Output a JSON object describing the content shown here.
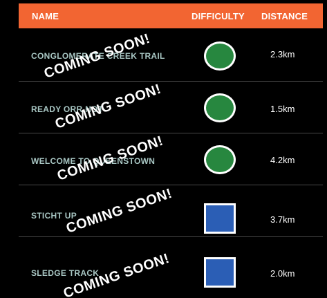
{
  "colors": {
    "header_background": "#f26532",
    "page_background": "#000000",
    "header_text": "#ffffff",
    "trail_name_text": "#a8c6c3",
    "easy_green": "#27873f",
    "intermediate_blue": "#2b5eb5",
    "divider": "#4a4a4a"
  },
  "table": {
    "headers": {
      "name": "NAME",
      "difficulty": "DIFFICULTY",
      "distance": "DISTANCE"
    },
    "rows": [
      {
        "name": "CONGLOMERATE CREEK TRAIL",
        "difficulty_icon": "green-circle-icon",
        "distance": "2.3km",
        "overlay": "COMING SOON!"
      },
      {
        "name": "READY ORR NOT",
        "difficulty_icon": "green-circle-icon",
        "distance": "1.5km",
        "overlay": "COMING SOON!"
      },
      {
        "name": "WELCOME TO QUEENSTOWN",
        "difficulty_icon": "green-circle-icon",
        "distance": "4.2km",
        "overlay": "COMING SOON!"
      },
      {
        "name": "STICHT UP",
        "difficulty_icon": "blue-square-icon",
        "distance": "3.7km",
        "overlay": "COMING SOON!"
      },
      {
        "name": "SLEDGE TRACK",
        "difficulty_icon": "blue-square-icon",
        "distance": "2.0km",
        "overlay": "COMING SOON!"
      }
    ]
  }
}
